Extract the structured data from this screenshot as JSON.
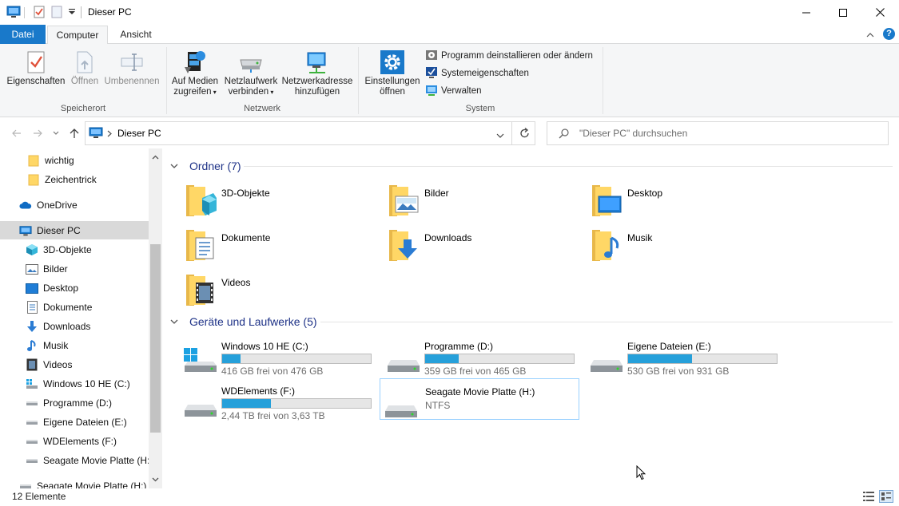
{
  "window": {
    "title": "Dieser PC",
    "min_label": "–",
    "max_label": "□",
    "close_label": "✕"
  },
  "ribbon_tabs": [
    {
      "label": "Datei"
    },
    {
      "label": "Computer"
    },
    {
      "label": "Ansicht"
    }
  ],
  "ribbon": {
    "groups": {
      "location": "Speicherort",
      "network": "Netzwerk",
      "system": "System"
    },
    "buttons": {
      "properties": "Eigenschaften",
      "open": "Öffnen",
      "rename": "Umbenennen",
      "media_line1": "Auf Medien",
      "media_line2": "zugreifen",
      "netdrive_line1": "Netzlaufwerk",
      "netdrive_line2": "verbinden",
      "netaddr_line1": "Netzwerkadresse",
      "netaddr_line2": "hinzufügen",
      "settings_line1": "Einstellungen",
      "settings_line2": "öffnen",
      "uninstall": "Programm deinstallieren oder ändern",
      "sysprops": "Systemeigenschaften",
      "manage": "Verwalten"
    },
    "help_label": "?"
  },
  "address": {
    "path": "Dieser PC",
    "search_placeholder": "\"Dieser PC\" durchsuchen"
  },
  "nav": {
    "items": [
      {
        "label": "wichtig",
        "icon": "folder-icon"
      },
      {
        "label": "Zeichentrick",
        "icon": "folder-icon"
      },
      {
        "label": "OneDrive",
        "icon": "cloud-icon"
      },
      {
        "label": "Dieser PC",
        "icon": "computer-icon"
      },
      {
        "label": "3D-Objekte",
        "icon": "cube-icon"
      },
      {
        "label": "Bilder",
        "icon": "picture-icon"
      },
      {
        "label": "Desktop",
        "icon": "desktop-icon"
      },
      {
        "label": "Dokumente",
        "icon": "document-icon"
      },
      {
        "label": "Downloads",
        "icon": "download-arrow-icon"
      },
      {
        "label": "Musik",
        "icon": "music-note-icon"
      },
      {
        "label": "Videos",
        "icon": "film-icon"
      },
      {
        "label": "Windows 10 HE (C:)",
        "icon": "system-drive-icon"
      },
      {
        "label": "Programme (D:)",
        "icon": "drive-icon"
      },
      {
        "label": "Eigene Dateien (E:)",
        "icon": "drive-icon"
      },
      {
        "label": "WDElements (F:)",
        "icon": "drive-icon"
      },
      {
        "label": "Seagate Movie Platte (H:)",
        "icon": "drive-icon"
      },
      {
        "label": "Seagate Movie Platte (H:)",
        "icon": "drive-icon"
      }
    ]
  },
  "content": {
    "folders_header": "Ordner (7)",
    "drives_header": "Geräte und Laufwerke (5)",
    "folders": [
      {
        "name": "3D-Objekte",
        "icon": "cube-folder-icon"
      },
      {
        "name": "Bilder",
        "icon": "pictures-folder-icon"
      },
      {
        "name": "Desktop",
        "icon": "desktop-folder-icon"
      },
      {
        "name": "Dokumente",
        "icon": "documents-folder-icon"
      },
      {
        "name": "Downloads",
        "icon": "downloads-folder-icon"
      },
      {
        "name": "Musik",
        "icon": "music-folder-icon"
      },
      {
        "name": "Videos",
        "icon": "videos-folder-icon"
      }
    ],
    "drives": [
      {
        "name": "Windows 10 HE (C:)",
        "free": "416 GB frei von 476 GB",
        "used_fraction": 0.126,
        "icon": "windows-drive-icon"
      },
      {
        "name": "Programme (D:)",
        "free": "359 GB frei von 465 GB",
        "used_fraction": 0.228,
        "icon": "drive-icon"
      },
      {
        "name": "Eigene Dateien (E:)",
        "free": "530 GB frei von 931 GB",
        "used_fraction": 0.431,
        "icon": "drive-icon"
      },
      {
        "name": "WDElements (F:)",
        "free": "2,44 TB frei von 3,63 TB",
        "used_fraction": 0.328,
        "icon": "drive-icon"
      },
      {
        "name": "Seagate Movie Platte (H:)",
        "fs": "NTFS",
        "icon": "drive-icon"
      }
    ]
  },
  "status": {
    "count": "12 Elemente"
  },
  "colors": {
    "accent": "#1979ca",
    "bar_fill": "#26a0da",
    "group_header": "#1e3287",
    "selection": "#d9d9d9"
  }
}
